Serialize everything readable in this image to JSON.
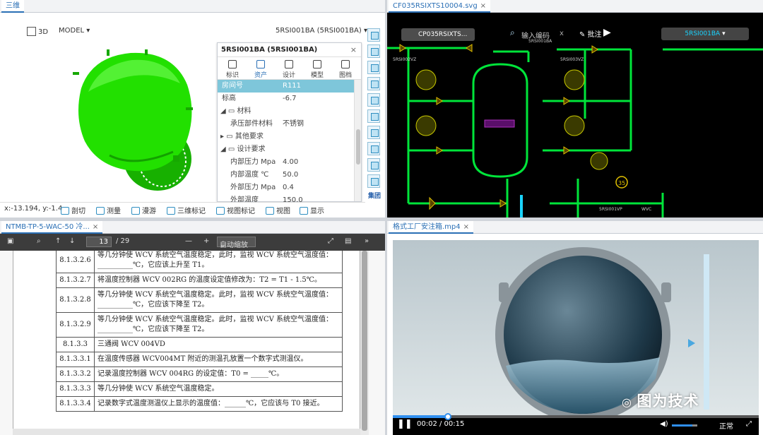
{
  "panes": {
    "model3d": {
      "tab": "三维",
      "view_label": "3D",
      "mode_label": "MODEL",
      "object_select": "5RSI001BA (5RSI001BA)",
      "coords": "x:-13.194, y:-1.4",
      "bottom_tools": [
        "剖切",
        "测量",
        "漫游",
        "三维标记",
        "视图标记",
        "视图",
        "显示"
      ],
      "logo_text": "集团"
    },
    "properties": {
      "title": "5RSI001BA (5RSI001BA)",
      "close": "×",
      "tabs": [
        "标识",
        "资产",
        "设计",
        "模型",
        "图档"
      ],
      "active_tab": "资产",
      "rows": [
        {
          "k": "房间号",
          "v": "R111"
        },
        {
          "k": "标高",
          "v": "-6.7"
        },
        {
          "k": "材料",
          "v": ""
        },
        {
          "k": "承压部件材料",
          "v": "不锈钢"
        },
        {
          "k": "其他要求",
          "v": ""
        },
        {
          "k": "设计要求",
          "v": ""
        },
        {
          "k": "内部压力 Mpa",
          "v": "4.00"
        },
        {
          "k": "内部温度 ℃",
          "v": "50.0"
        },
        {
          "k": "外部压力 Mpa",
          "v": "0.4"
        },
        {
          "k": "外部温度",
          "v": "150.0"
        }
      ]
    },
    "svg": {
      "tab": "CF035RSIXTS10004.svg",
      "close": "×",
      "doc_label": "CP035RSIXTS...",
      "search_placeholder": "输入编码",
      "search_clear": "x",
      "annot_label": "批注",
      "object_select": "5RSI001BA",
      "tag_number": "35",
      "labels": [
        "5RSI001BA",
        "5RSI002VZ",
        "5RSI003VZ",
        "5RSI001VP",
        "WVC"
      ]
    },
    "pdf": {
      "tab": "NTMB-TP-5-WAC-50 冷...",
      "close": "×",
      "page_current": "13",
      "page_total": "/ 29",
      "zoom": "自动缩放",
      "rows": [
        {
          "n": "8.1.3.2.6",
          "t": "等几分钟使 WCV 系统空气温度稳定，此时，监视 WCV 系统空气温度值：__________℃，它应该上升至 T1。"
        },
        {
          "n": "8.1.3.2.7",
          "t": "将温度控制器 WCV 002RG 的温度设定值修改为：T2 = T1 - 1.5℃。"
        },
        {
          "n": "8.1.3.2.8",
          "t": "等几分钟使 WCV 系统空气温度稳定。此时，监视 WCV 系统空气温度值：__________℃，它应该下降至 T2。"
        },
        {
          "n": "8.1.3.2.9",
          "t": "等几分钟使 WCV 系统空气温度稳定。此时，监视 WCV 系统空气温度值：__________℃，它应该下降至 T2。"
        },
        {
          "n": "8.1.3.3",
          "t": "三通阀 WCV 004VD"
        },
        {
          "n": "8.1.3.3.1",
          "t": "在温度传感器 WCV004MT 附近的测温孔放置一个数字式测温仪。"
        },
        {
          "n": "8.1.3.3.2",
          "t": "记录温度控制器 WCV 004RG 的设定值：T0 = _____℃。"
        },
        {
          "n": "8.1.3.3.3",
          "t": "等几分钟使 WCV 系统空气温度稳定。"
        },
        {
          "n": "8.1.3.3.4",
          "t": "记录数字式温度测温仪上显示的温度值：______℃，它应该与 T0 接近。"
        }
      ]
    },
    "video": {
      "tab": "格式工厂安注箱.mp4",
      "close": "×",
      "time": "00:02 / 00:15",
      "progress": 0.15,
      "volume": 0.8,
      "speed": "正常",
      "watermark": "图为技术"
    }
  },
  "colors": {
    "accent": "#2a6fb5",
    "model_green": "#22e000",
    "pipe_green": "#00e53a",
    "selected_row": "#7ec6da"
  }
}
